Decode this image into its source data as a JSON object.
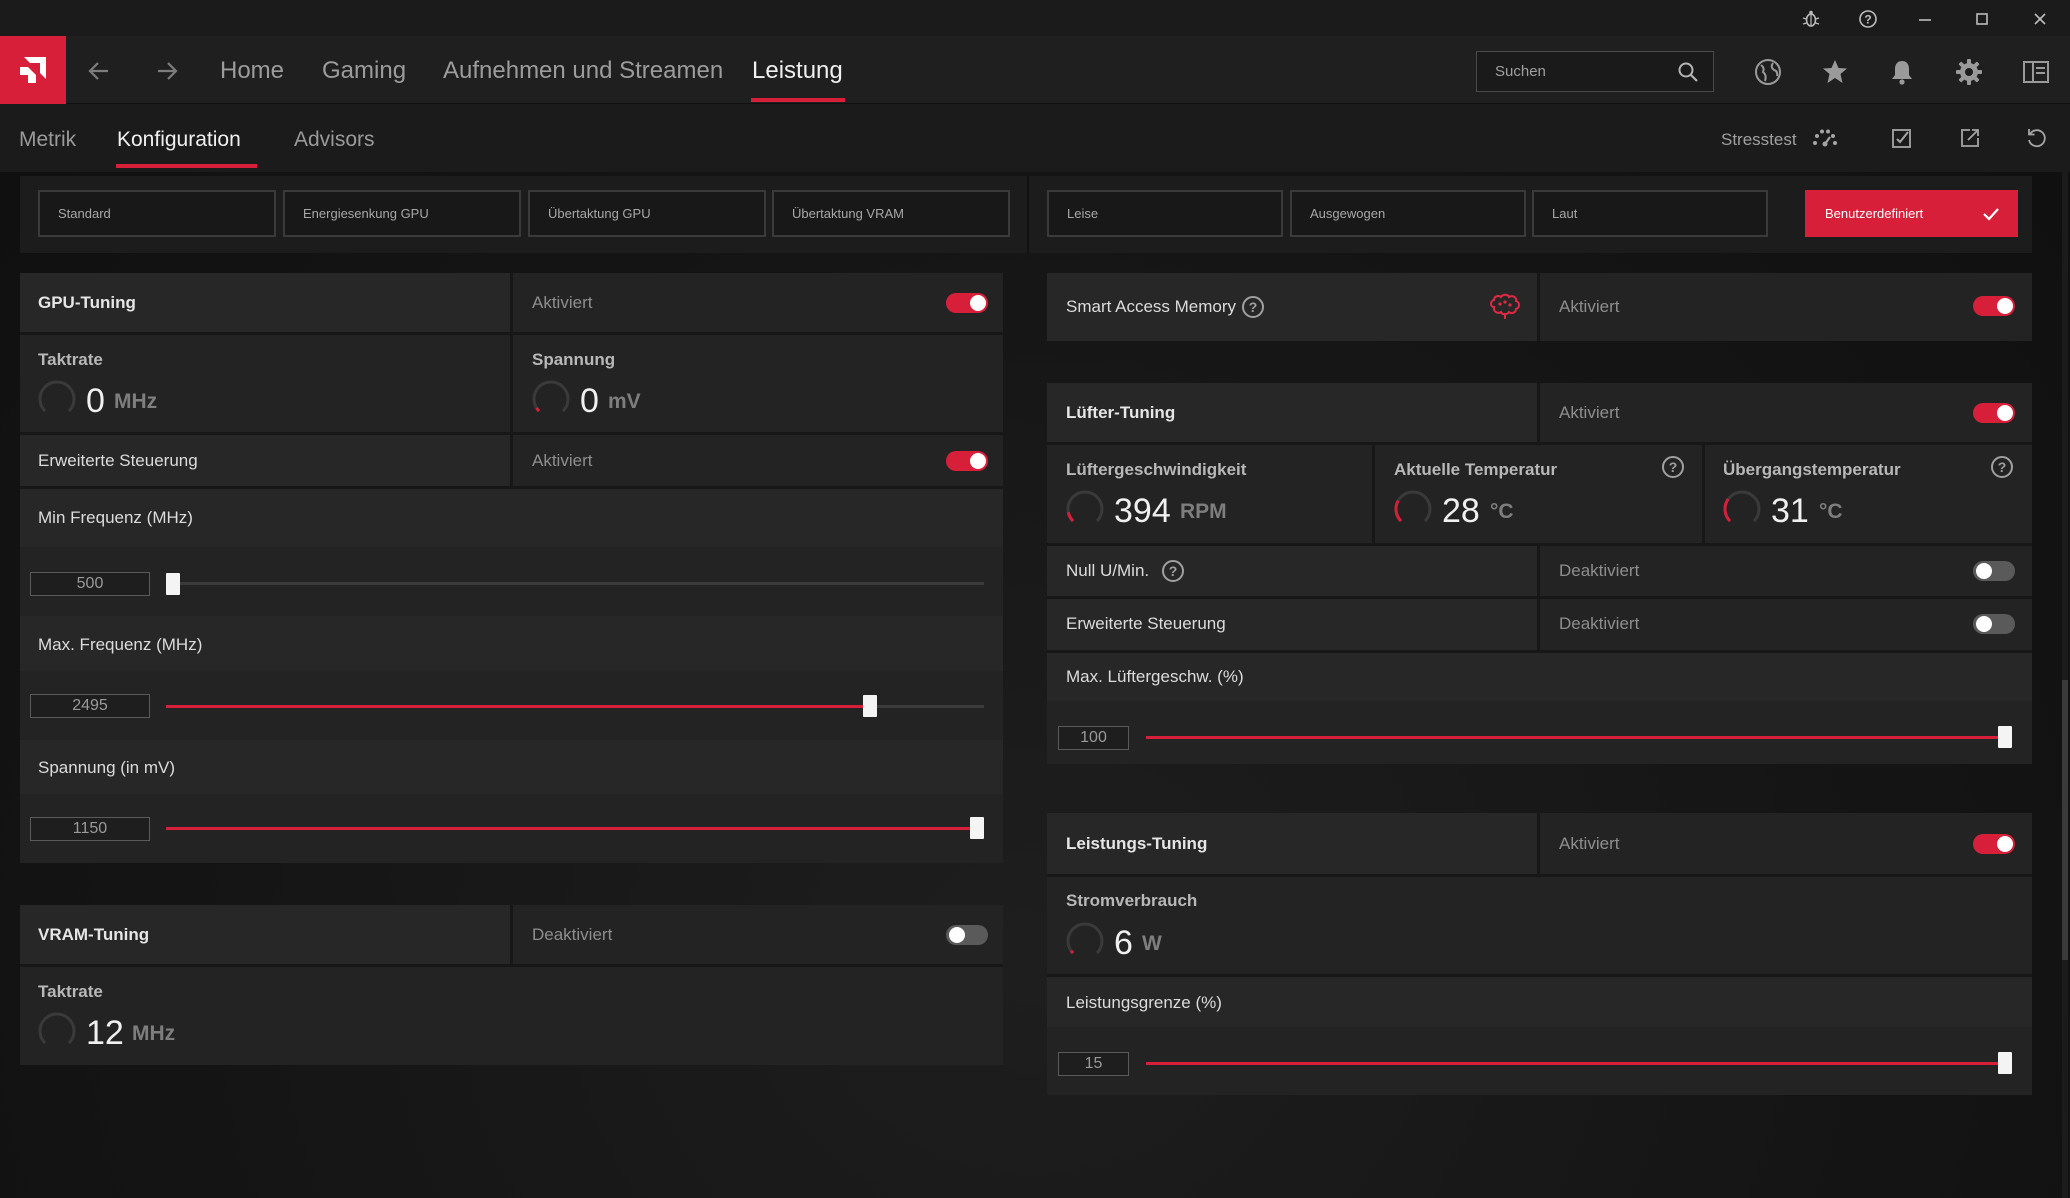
{
  "nav": {
    "items": [
      "Home",
      "Gaming",
      "Aufnehmen und Streamen",
      "Leistung"
    ],
    "active": "Leistung",
    "search_placeholder": "Suchen"
  },
  "subnav": {
    "items": [
      "Metrik",
      "Konfiguration",
      "Advisors"
    ],
    "active": "Konfiguration",
    "stresstest": "Stresstest"
  },
  "presets_gpu": [
    "Standard",
    "Energiesenkung GPU",
    "Übertaktung GPU",
    "Übertaktung VRAM"
  ],
  "presets_fan": [
    "Leise",
    "Ausgewogen",
    "Laut"
  ],
  "preset_custom": "Benutzerdefiniert",
  "gpu_tuning": {
    "title": "GPU-Tuning",
    "status": "Aktiviert",
    "enabled": true,
    "clock": {
      "title": "Taktrate",
      "value": "0",
      "unit": "MHz"
    },
    "voltage": {
      "title": "Spannung",
      "value": "0",
      "unit": "mV"
    },
    "advanced": {
      "label": "Erweiterte Steuerung",
      "status": "Aktiviert",
      "enabled": true
    },
    "min_freq": {
      "label": "Min Frequenz (MHz)",
      "value": "500",
      "fraction": 0.0
    },
    "max_freq": {
      "label": "Max. Frequenz (MHz)",
      "value": "2495",
      "fraction": 0.86
    },
    "voltage_slider": {
      "label": "Spannung (in mV)",
      "value": "1150",
      "fraction": 1.0
    }
  },
  "vram_tuning": {
    "title": "VRAM-Tuning",
    "status": "Deaktiviert",
    "enabled": false,
    "clock": {
      "title": "Taktrate",
      "value": "12",
      "unit": "MHz"
    }
  },
  "sam": {
    "label": "Smart Access Memory",
    "help": "?",
    "status": "Aktiviert",
    "enabled": true
  },
  "fan_tuning": {
    "title": "Lüfter-Tuning",
    "status": "Aktiviert",
    "enabled": true,
    "speed": {
      "title": "Lüftergeschwindigkeit",
      "value": "394",
      "unit": "RPM"
    },
    "temp": {
      "title": "Aktuelle Temperatur",
      "value": "28",
      "unit": "°C"
    },
    "junction": {
      "title": "Übergangstemperatur",
      "value": "31",
      "unit": "°C"
    },
    "zero_rpm": {
      "label": "Null U/Min.",
      "status": "Deaktiviert",
      "enabled": false
    },
    "advanced": {
      "label": "Erweiterte Steuerung",
      "status": "Deaktiviert",
      "enabled": false
    },
    "max_speed": {
      "label": "Max. Lüftergeschw. (%)",
      "value": "100",
      "fraction": 1.0
    }
  },
  "power_tuning": {
    "title": "Leistungs-Tuning",
    "status": "Aktiviert",
    "enabled": true,
    "power": {
      "title": "Stromverbrauch",
      "value": "6",
      "unit": "W"
    },
    "limit": {
      "label": "Leistungsgrenze (%)",
      "value": "15",
      "fraction": 1.0
    }
  },
  "colors": {
    "accent": "#d71f3a",
    "background": "#121212",
    "card": "#232323"
  },
  "icons": [
    "bug-icon",
    "help-icon",
    "minimize-icon",
    "maximize-icon",
    "close-icon",
    "amd-logo-icon",
    "back-arrow-icon",
    "forward-arrow-icon",
    "search-icon",
    "globe-icon",
    "star-icon",
    "bell-icon",
    "gear-icon",
    "sidebar-icon",
    "gauge-icon",
    "checklist-icon",
    "export-icon",
    "reset-icon",
    "checkmark-icon",
    "brain-icon"
  ]
}
